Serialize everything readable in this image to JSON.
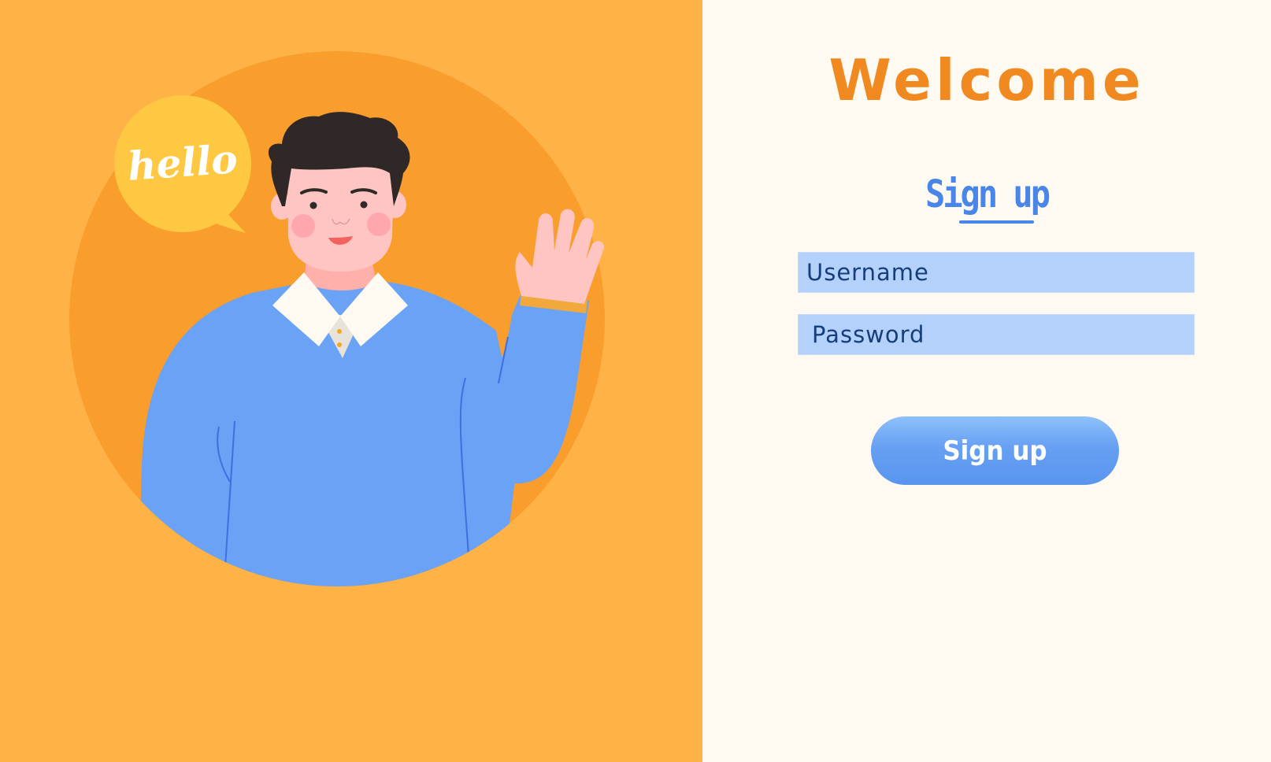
{
  "illustration": {
    "speech_bubble_text": "hello"
  },
  "form": {
    "title": "Welcome",
    "tab_label": "Sign up",
    "username": {
      "value": "",
      "placeholder": "Username"
    },
    "password": {
      "value": "",
      "placeholder": "Password"
    },
    "submit_label": "Sign up"
  },
  "colors": {
    "left_background": "#ffb347",
    "circle": "#f99d2c",
    "bubble": "#fec842",
    "sweater": "#6aa2f5",
    "right_background": "#fefaf1",
    "title": "#f0891f",
    "accent_blue": "#4a86e8",
    "input_background": "#b3d1fb",
    "input_text": "#163e7a"
  },
  "icons": {
    "illustration": "waving-man-illustration",
    "bubble": "speech-bubble-icon"
  }
}
